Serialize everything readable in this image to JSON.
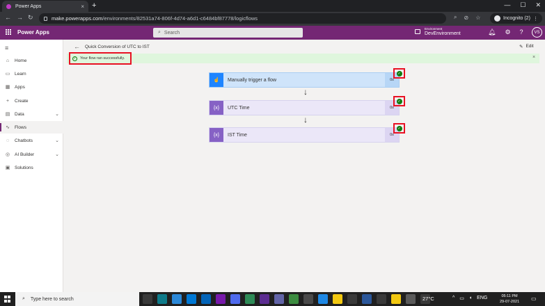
{
  "browser": {
    "tab_title": "Power Apps",
    "tab_close": "×",
    "new_tab": "+",
    "url_domain": "make.powerapps.com",
    "url_path": "/environments/82531a74-806f-4d74-a6d1-c6484bf87778/logicflows",
    "profile": "Incognito (2)",
    "controls": [
      "—",
      "☐",
      "✕"
    ]
  },
  "app": {
    "name": "Power Apps",
    "search_placeholder": "Search",
    "environment_label": "Environment",
    "environment_name": "DevEnvironment",
    "user_initials": "VS",
    "brand_color": "#742774"
  },
  "nav": {
    "items": [
      {
        "label": "Home",
        "icon": "⌂",
        "chevron": ""
      },
      {
        "label": "Learn",
        "icon": "▭",
        "chevron": ""
      },
      {
        "label": "Apps",
        "icon": "▦",
        "chevron": ""
      },
      {
        "label": "Create",
        "icon": "+",
        "chevron": ""
      },
      {
        "label": "Data",
        "icon": "▤",
        "chevron": "⌄"
      },
      {
        "label": "Flows",
        "icon": "∿",
        "chevron": ""
      },
      {
        "label": "Chatbots",
        "icon": "◌",
        "chevron": "⌄"
      },
      {
        "label": "AI Builder",
        "icon": "◎",
        "chevron": "⌄"
      },
      {
        "label": "Solutions",
        "icon": "▣",
        "chevron": ""
      }
    ]
  },
  "page": {
    "title": "Quick Conversion of UTC to IST",
    "edit_label": "Edit",
    "banner_text": "Your flow ran successfully.",
    "banner_close": "×"
  },
  "flow": {
    "steps": [
      {
        "label": "Manually trigger a flow",
        "duration": "0s",
        "icon": "☝"
      },
      {
        "label": "UTC Time",
        "duration": "0s",
        "icon": "{x}"
      },
      {
        "label": "IST Time",
        "duration": "0s",
        "icon": "{x}"
      }
    ],
    "arrow": "↓",
    "check": "✓"
  },
  "taskbar": {
    "search_text": "Type here to search",
    "weather": "27°C",
    "language": "ENG",
    "time": "05:11 PM",
    "date": "29-07-2021"
  }
}
